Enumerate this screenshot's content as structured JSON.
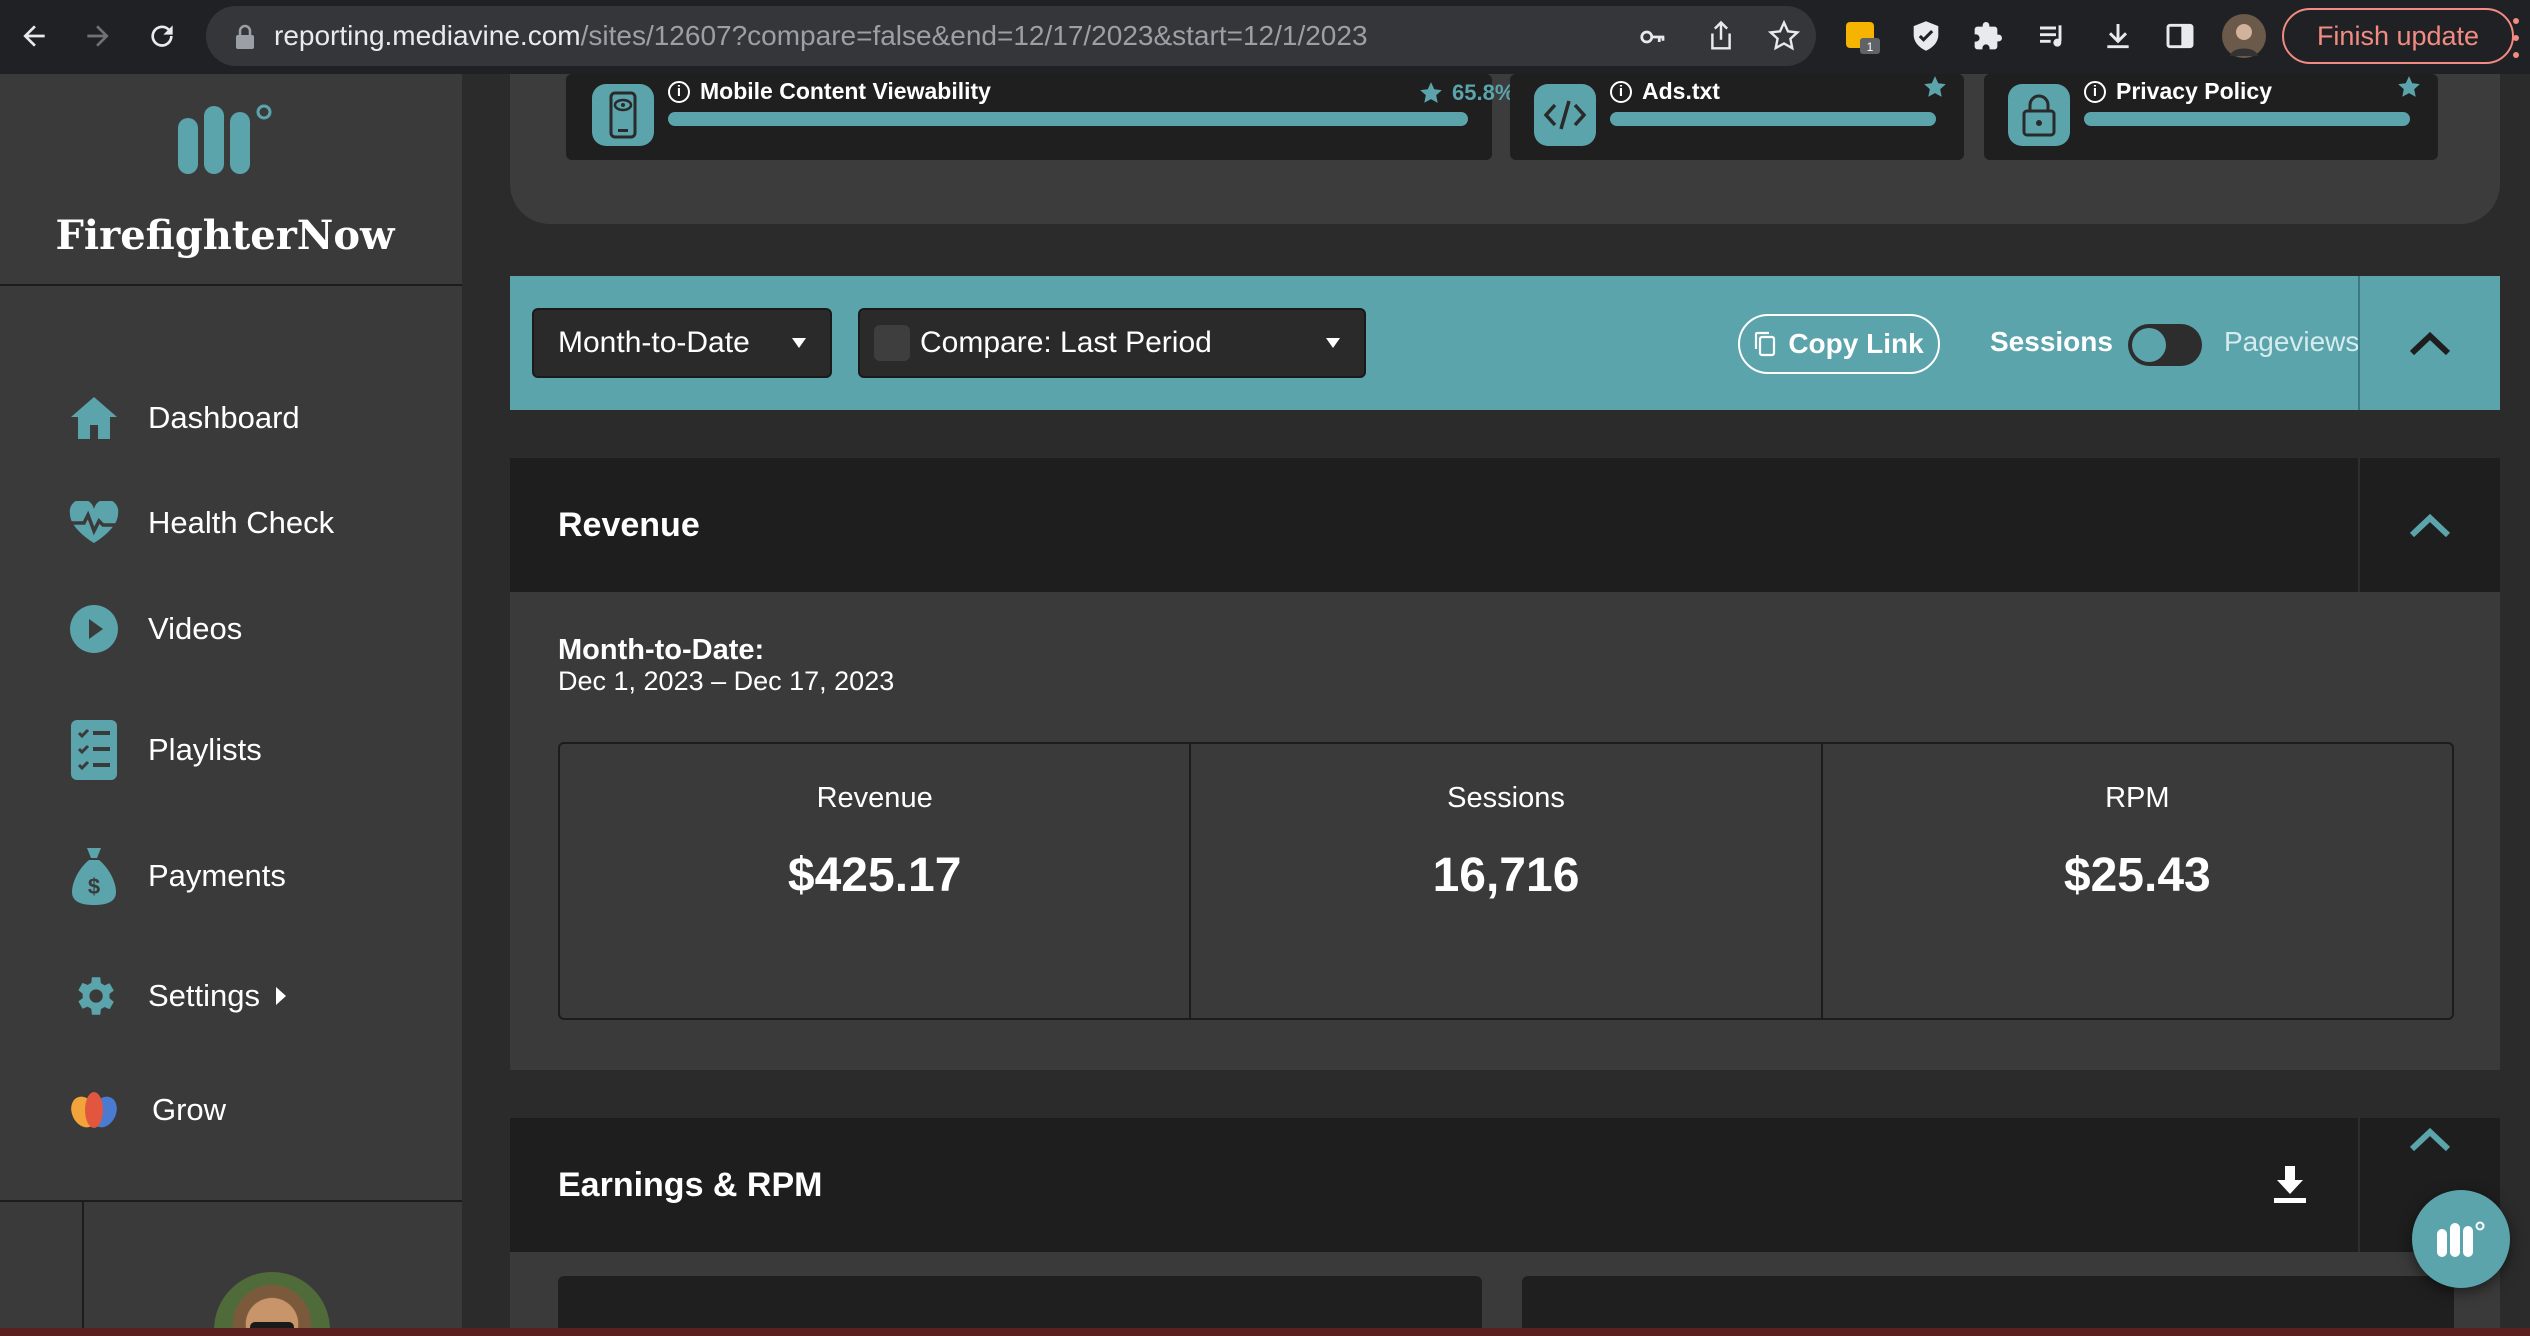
{
  "browser": {
    "url_domain": "reporting.mediavine.com",
    "url_path": "/sites/12607?compare=false&end=12/17/2023&start=12/1/2023",
    "extension_badge": "1",
    "finish_update_label": "Finish update"
  },
  "sidebar": {
    "site_name": "FirefighterNow",
    "items": [
      {
        "label": "Dashboard",
        "icon": "home-icon"
      },
      {
        "label": "Health Check",
        "icon": "heartbeat-icon"
      },
      {
        "label": "Videos",
        "icon": "play-icon"
      },
      {
        "label": "Playlists",
        "icon": "list-icon"
      },
      {
        "label": "Payments",
        "icon": "money-bag-icon"
      },
      {
        "label": "Settings",
        "icon": "gear-icon"
      },
      {
        "label": "Grow",
        "icon": "grow-icon"
      }
    ]
  },
  "health_check": {
    "cards": [
      {
        "title": "Mobile Content Viewability",
        "score": "65.8%",
        "icon": "mobile-eye-icon"
      },
      {
        "title": "Ads.txt",
        "score": "",
        "icon": "code-icon"
      },
      {
        "title": "Privacy Policy",
        "score": "",
        "icon": "lock-icon"
      }
    ]
  },
  "filters": {
    "date_range": "Month-to-Date",
    "compare": "Compare: Last Period",
    "compare_checked": false,
    "copy_link": "Copy Link",
    "toggle_left": "Sessions",
    "toggle_right": "Pageviews",
    "toggle_state": "Sessions"
  },
  "revenue": {
    "title": "Revenue",
    "period_label": "Month-to-Date:",
    "period_range": "Dec 1, 2023 – Dec 17, 2023",
    "stats": [
      {
        "label": "Revenue",
        "value": "$425.17"
      },
      {
        "label": "Sessions",
        "value": "16,716"
      },
      {
        "label": "RPM",
        "value": "$25.43"
      }
    ]
  },
  "earnings": {
    "title": "Earnings & RPM"
  },
  "colors": {
    "accent": "#5ba4ac",
    "panel": "#3a3a3a",
    "header": "#1e1e1e",
    "chrome": "#202124"
  }
}
